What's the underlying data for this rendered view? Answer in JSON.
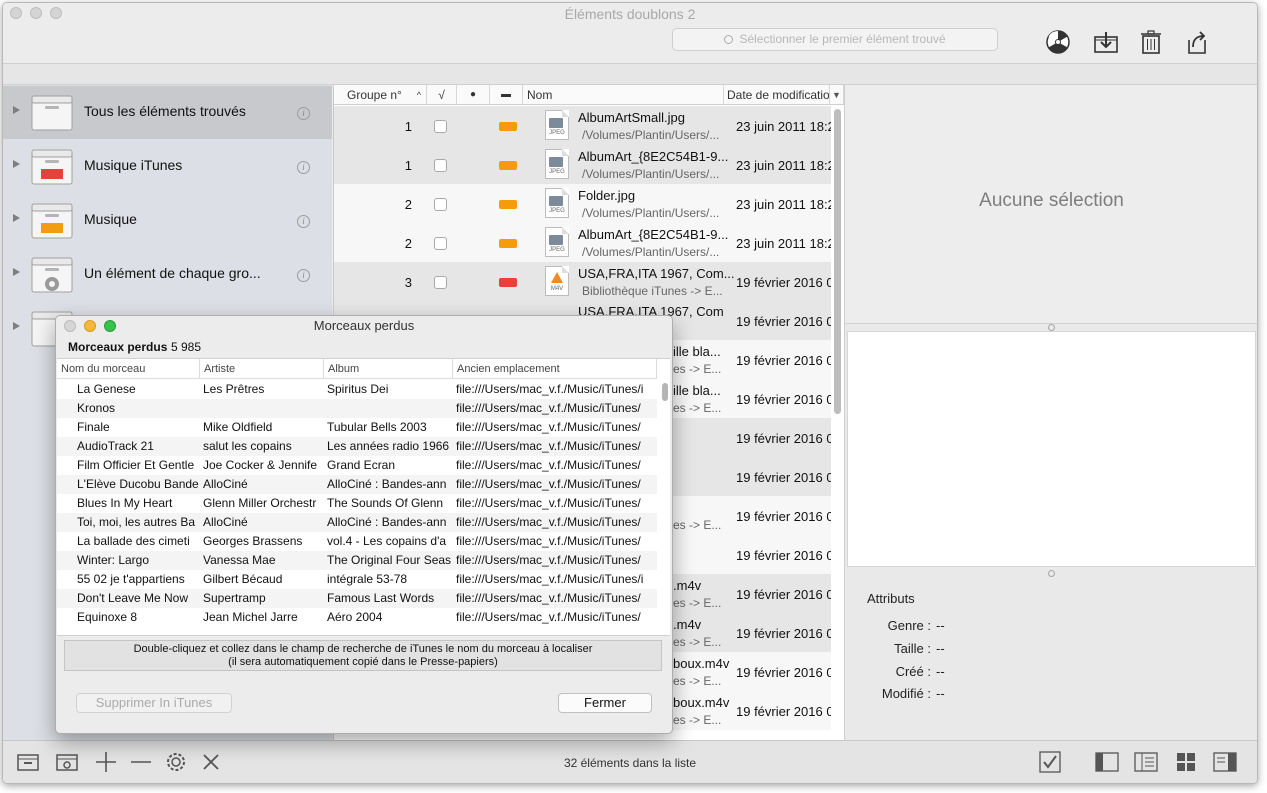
{
  "window": {
    "title": "Éléments doublons 2"
  },
  "toolbar": {
    "search_placeholder": "Sélectionner le premier élément trouvé"
  },
  "sidebar": {
    "items": [
      {
        "label": "Tous les éléments trouvés",
        "color": "#f2f2f2"
      },
      {
        "label": "Musique iTunes",
        "color": "#e8403b"
      },
      {
        "label": "Musique",
        "color": "#f39c12"
      },
      {
        "label": "Un élément de chaque gro..."
      }
    ]
  },
  "table": {
    "columns": [
      "Groupe n°",
      "√",
      "●",
      "▬",
      "Nom",
      "Date de modificatio"
    ],
    "rows": [
      {
        "group": "1",
        "color": "#f59b0c",
        "name": "AlbumArtSmall.jpg",
        "path": "/Volumes/Plantin/Users/...",
        "date": "23 juin 2011 18:2",
        "type": "JPEG"
      },
      {
        "group": "1",
        "color": "#f59b0c",
        "name": "AlbumArt_{8E2C54B1-9...",
        "path": "/Volumes/Plantin/Users/...",
        "date": "23 juin 2011 18:2",
        "type": "JPEG"
      },
      {
        "group": "2",
        "color": "#f59b0c",
        "name": "Folder.jpg",
        "path": "/Volumes/Plantin/Users/...",
        "date": "23 juin 2011 18:2",
        "type": "JPEG"
      },
      {
        "group": "2",
        "color": "#f59b0c",
        "name": "AlbumArt_{8E2C54B1-9...",
        "path": "/Volumes/Plantin/Users/...",
        "date": "23 juin 2011 18:2",
        "type": "JPEG"
      },
      {
        "group": "3",
        "color": "#e8403b",
        "name": "USA,FRA,ITA 1967, Com...",
        "path": "Bibliothèque iTunes -> E...",
        "date": "19 février 2016 0",
        "type": "M4V"
      },
      {
        "group": "",
        "color": "",
        "name": "USA,FRA,ITA 1967, Com",
        "path": "",
        "date": "19 février 2016 0",
        "type": ""
      }
    ],
    "partial_rows": [
      {
        "name": "ille bla...",
        "path": "es -> E...",
        "date": "19 février 2016 0"
      },
      {
        "name": "ille bla...",
        "path": "es -> E...",
        "date": "19 février 2016 0"
      },
      {
        "name": "",
        "path": "",
        "date": "19 février 2016 0"
      },
      {
        "name": "",
        "path": "",
        "date": "19 février 2016 0"
      },
      {
        "name": "",
        "path": "es -> E...",
        "date": "19 février 2016 0"
      },
      {
        "name": "",
        "path": "",
        "date": "19 février 2016 0"
      },
      {
        "name": ".m4v",
        "path": "es -> E...",
        "date": "19 février 2016 0"
      },
      {
        "name": ".m4v",
        "path": "es -> E...",
        "date": "19 février 2016 0"
      },
      {
        "name": "boux.m4v",
        "path": "es -> E...",
        "date": "19 février 2016 0"
      },
      {
        "name": "boux.m4v",
        "path": "es -> E...",
        "date": "19 février 2016 0"
      }
    ]
  },
  "inspector": {
    "empty_label": "Aucune sélection",
    "attributes_title": "Attributs",
    "attributes": [
      {
        "key": "Genre :",
        "value": "--"
      },
      {
        "key": "Taille :",
        "value": "--"
      },
      {
        "key": "Créé :",
        "value": "--"
      },
      {
        "key": "Modifié :",
        "value": "--"
      }
    ]
  },
  "statusbar": {
    "count_text": "32 éléments dans la liste"
  },
  "dialog": {
    "title": "Morceaux perdus",
    "heading": "Morceaux perdus",
    "count": "5 985",
    "columns": [
      "Nom du morceau",
      "Artiste",
      "Album",
      "Ancien emplacement"
    ],
    "rows": [
      [
        "La Genese",
        "Les Prêtres",
        "Spiritus Dei",
        "file:///Users/mac_v.f./Music/iTunes/i"
      ],
      [
        "Kronos",
        "",
        "",
        "file:///Users/mac_v.f./Music/iTunes/"
      ],
      [
        "Finale",
        "Mike Oldfield",
        "Tubular Bells 2003",
        "file:///Users/mac_v.f./Music/iTunes/"
      ],
      [
        "AudioTrack 21",
        "salut les copains",
        "Les années radio 1966",
        "file:///Users/mac_v.f./Music/iTunes/"
      ],
      [
        "Film Officier Et Gentle",
        "Joe Cocker & Jennife",
        "Grand Ecran",
        "file:///Users/mac_v.f./Music/iTunes/"
      ],
      [
        "L'Elève Ducobu Bande",
        "AlloCiné",
        "AlloCiné : Bandes-ann",
        "file:///Users/mac_v.f./Music/iTunes/"
      ],
      [
        "Blues In My Heart",
        "Glenn Miller Orchestr",
        "The Sounds Of Glenn",
        "file:///Users/mac_v.f./Music/iTunes/"
      ],
      [
        "Toi, moi, les autres Ba",
        "AlloCiné",
        "AlloCiné : Bandes-ann",
        "file:///Users/mac_v.f./Music/iTunes/"
      ],
      [
        "La ballade des cimeti",
        "Georges Brassens",
        "vol.4 - Les copains d'a",
        "file:///Users/mac_v.f./Music/iTunes/"
      ],
      [
        "Winter: Largo",
        "Vanessa Mae",
        "The Original Four Seas",
        "file:///Users/mac_v.f./Music/iTunes/"
      ],
      [
        "55 02 je t'appartiens",
        "Gilbert Bécaud",
        "intégrale 53-78",
        "file:///Users/mac_v.f./Music/iTunes/i"
      ],
      [
        "Don't Leave Me Now",
        "Supertramp",
        "Famous Last Words",
        "file:///Users/mac_v.f./Music/iTunes/"
      ],
      [
        "Equinoxe 8",
        "Jean Michel Jarre",
        "Aéro 2004",
        "file:///Users/mac_v.f./Music/iTunes/"
      ]
    ],
    "message_line1": "Double-cliquez et collez dans le champ de recherche de iTunes le nom du morceau à localiser",
    "message_line2": "(il sera automatiquement copié dans le Presse-papiers)",
    "delete_button": "Supprimer In iTunes",
    "close_button": "Fermer"
  }
}
